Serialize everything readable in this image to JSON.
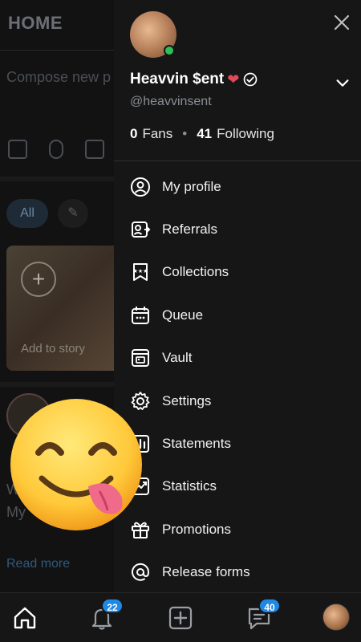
{
  "header": {
    "title": "HOME"
  },
  "compose": {
    "placeholder": "Compose new p"
  },
  "filters": {
    "all_label": "All"
  },
  "story": {
    "add_label": "Add to story"
  },
  "post": {
    "line1": "W",
    "line2": "My",
    "read_more": "Read more"
  },
  "drawer": {
    "name": "Heavvin $ent",
    "handle": "@heavvinsent",
    "fans_count": "0",
    "fans_label": "Fans",
    "following_count": "41",
    "following_label": "Following",
    "menu": [
      {
        "label": "My profile",
        "icon": "user-circle-icon"
      },
      {
        "label": "Referrals",
        "icon": "referral-icon"
      },
      {
        "label": "Collections",
        "icon": "collections-icon"
      },
      {
        "label": "Queue",
        "icon": "calendar-icon"
      },
      {
        "label": "Vault",
        "icon": "vault-icon"
      },
      {
        "label": "Settings",
        "icon": "gear-icon"
      },
      {
        "label": "Statements",
        "icon": "statements-icon"
      },
      {
        "label": "Statistics",
        "icon": "statistics-icon"
      },
      {
        "label": "Promotions",
        "icon": "gift-icon"
      },
      {
        "label": "Release forms",
        "icon": "at-icon"
      }
    ]
  },
  "bottom_nav": {
    "notifications_badge": "22",
    "messages_badge": "40"
  },
  "colors": {
    "accent": "#1e88e5",
    "online": "#2fbf5a",
    "drawer_bg": "#161616"
  }
}
